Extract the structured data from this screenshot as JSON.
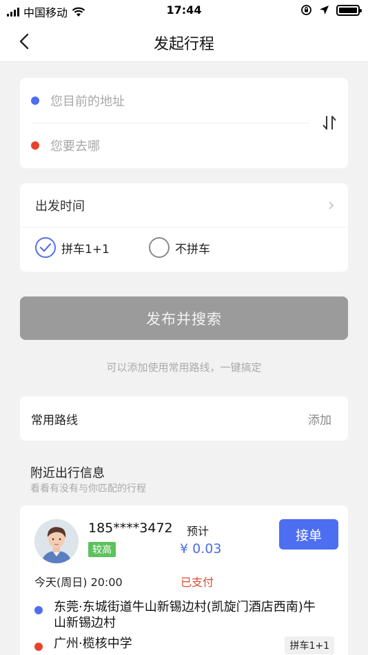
{
  "status_bar": {
    "carrier": "中国移动",
    "time": "17:44"
  },
  "nav": {
    "title": "发起行程"
  },
  "address": {
    "origin_placeholder": "您目前的地址",
    "destination_placeholder": "您要去哪"
  },
  "departure": {
    "label": "出发时间",
    "options": [
      {
        "label": "拼车1+1",
        "checked": true
      },
      {
        "label": "不拼车",
        "checked": false
      }
    ]
  },
  "publish_button": "发布并搜索",
  "hint": "可以添加使用常用路线，一键搞定",
  "common_routes": {
    "title": "常用路线",
    "add": "添加"
  },
  "nearby": {
    "title": "附近出行信息",
    "subtitle": "看看有没有与你匹配的行程"
  },
  "trip": {
    "phone": "185****3472",
    "level": "较高",
    "estimate_label": "预计",
    "price": "¥ 0.03",
    "accept_button": "接单",
    "time": "今天(周日) 20:00",
    "payment_status": "已支付",
    "from": "东莞·东城街道牛山新锡边村(凯旋门酒店西南)牛山新锡边村",
    "to": "广州·榄核中学",
    "carpool_tag": "拼车1+1"
  },
  "colors": {
    "accent": "#4d6ef0",
    "origin_dot": "#4d6ef0",
    "destination_dot": "#e8432a",
    "paid": "#e04b2e",
    "level_badge": "#5cc25c",
    "disabled_button": "#9b9b9b"
  },
  "icons": [
    "signal-icon",
    "wifi-icon",
    "rotation-lock-icon",
    "location-arrow-icon",
    "battery-icon",
    "back-arrow-icon",
    "swap-icon",
    "chevron-right-icon",
    "check-icon",
    "avatar"
  ]
}
